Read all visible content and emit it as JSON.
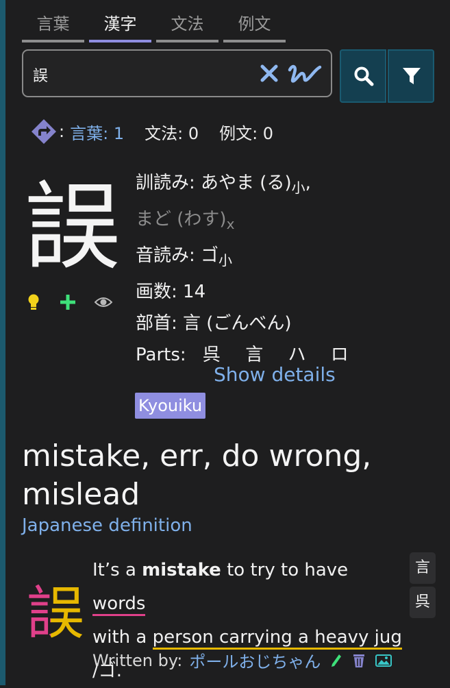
{
  "tabs": [
    {
      "label": "言葉",
      "active": false
    },
    {
      "label": "漢字",
      "active": true
    },
    {
      "label": "文法",
      "active": false
    },
    {
      "label": "例文",
      "active": false
    }
  ],
  "search": {
    "value": "誤"
  },
  "counts": {
    "separator": ":",
    "words_label": "言葉:",
    "words_count": "1",
    "grammar": "文法: 0",
    "sentences": "例文: 0"
  },
  "kanji": {
    "character": "誤",
    "kun_label": "訓読み:",
    "kun_reading": "あやま (る)",
    "kun_suffix": "小",
    "kun_comma": ",",
    "kun_reading2": "まど (わす)",
    "kun_suffix2": "x",
    "on_label": "音読み:",
    "on_reading": "ゴ",
    "on_suffix": "小",
    "strokes": "画数: 14",
    "radical": "部首: 言 (ごんべん)",
    "parts_label": "Parts:",
    "parts": [
      "呉",
      "言",
      "ハ",
      "ロ"
    ]
  },
  "show_details": "Show details",
  "level_badge": "Kyouiku",
  "meaning": "mistake, err, do wrong, mislead",
  "japanese_definition": "Japanese definition",
  "mnemonic": {
    "kanji": "誤",
    "t1": "It’s a ",
    "t2": "mistake",
    "t3": " to try to have ",
    "t4": "words",
    "t5": "with a ",
    "t6": "person carrying a heavy jug",
    "t7": "/ゴ.",
    "radical1": "言",
    "radical2": "呉",
    "written_by_label": "Written by:",
    "author": "ポールおじちゃん"
  },
  "colors": {
    "accent": "#8f8ee0",
    "link": "#7fb0ea",
    "mnemonic_pink": "#e0408a",
    "mnemonic_yellow": "#e6b800"
  }
}
